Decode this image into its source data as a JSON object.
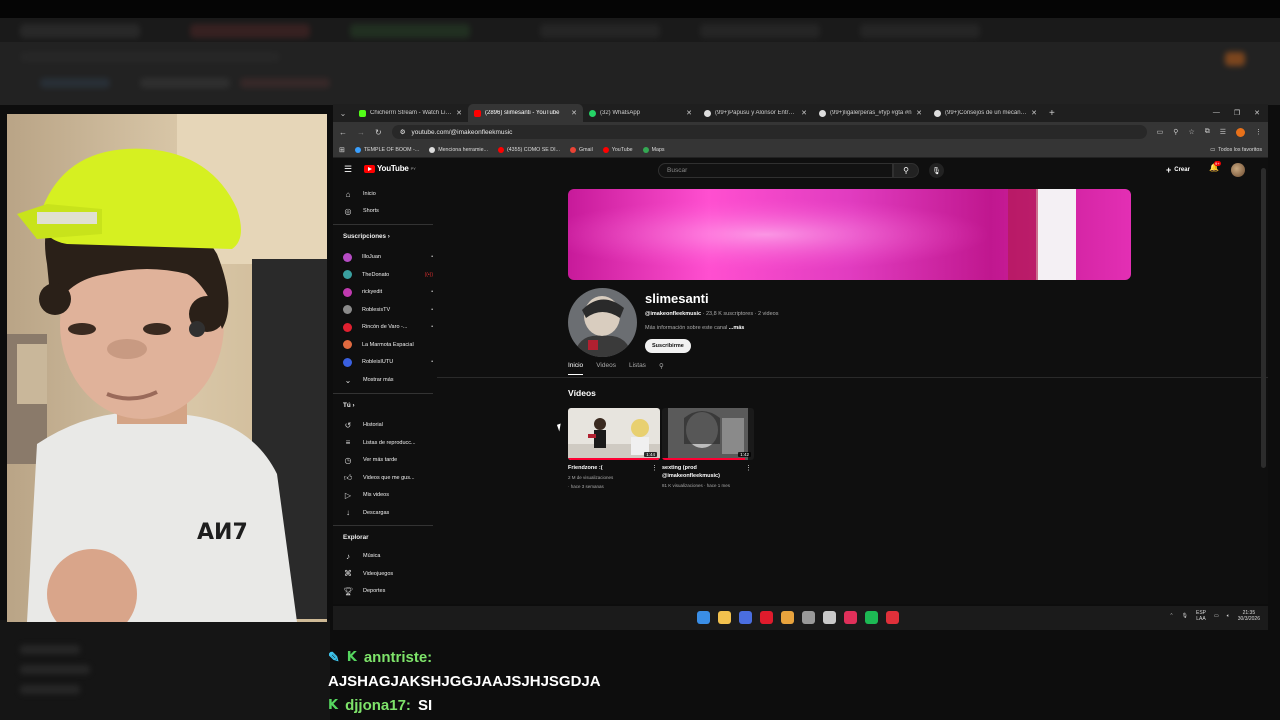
{
  "tabs": [
    {
      "label": "Chicherrri Stream - Watch Live on Kick",
      "icon_color": "#53fc18",
      "active": false
    },
    {
      "label": "(2896) slimesanti - YouTube",
      "icon_color": "#ff0000",
      "active": true
    },
    {
      "label": "(32) WhatsApp",
      "icon_color": "#25d366",
      "active": false
    },
    {
      "label": "(99+)Papusu y Alonsor Entre Amigos",
      "icon_color": "#ffffff",
      "active": false
    },
    {
      "label": "(99+)ligalerperas_#fyp #gta #n",
      "icon_color": "#ffffff",
      "active": false
    },
    {
      "label": "(99+)Consejos de un mecánico",
      "icon_color": "#ffffff",
      "active": false
    }
  ],
  "address": {
    "url": "youtube.com/@imakeonfleekmusic"
  },
  "bookmarks": [
    {
      "label": "TEMPLE OF BOOM -...",
      "color": "#3aa0ff"
    },
    {
      "label": "Menciona herramie...",
      "color": "#dddddd"
    },
    {
      "label": "(4355) COMO SE DI...",
      "color": "#ff0000"
    },
    {
      "label": "Gmail",
      "color": "#ea4335"
    },
    {
      "label": "YouTube",
      "color": "#ff0000"
    },
    {
      "label": "Maps",
      "color": "#34a853"
    }
  ],
  "bookmarks_right": "Todos los favoritos",
  "yt": {
    "logo": "YouTube",
    "logo_region": "PY",
    "search_placeholder": "Buscar",
    "create_label": "Crear",
    "bell_badge": "9+"
  },
  "sidebar": {
    "main": [
      {
        "label": "Inicio",
        "icon": "home-icon"
      },
      {
        "label": "Shorts",
        "icon": "shorts-icon"
      }
    ],
    "subs_header": "Suscripciones",
    "subs": [
      {
        "label": "IlloJuan",
        "color": "#b64cc4",
        "live": "•"
      },
      {
        "label": "TheDonato",
        "color": "#3aa0a0",
        "live": "((•))"
      },
      {
        "label": "rickyedit",
        "color": "#c03ab0",
        "live": "•"
      },
      {
        "label": "RoblesisTV",
        "color": "#8a8a8a",
        "live": "•"
      },
      {
        "label": "Rincón de Varo -...",
        "color": "#e02030",
        "live": "•"
      },
      {
        "label": "La Marmota Espacial",
        "color": "#e06a40",
        "live": ""
      },
      {
        "label": "RobleisIUTU",
        "color": "#3a60e0",
        "live": "•"
      }
    ],
    "show_more": "Mostrar más",
    "you_header": "Tú",
    "you": [
      {
        "label": "Historial",
        "icon": "history-icon"
      },
      {
        "label": "Listas de reproducc...",
        "icon": "playlists-icon"
      },
      {
        "label": "Ver más tarde",
        "icon": "watch-later-icon"
      },
      {
        "label": "Videos que me gus...",
        "icon": "like-icon"
      },
      {
        "label": "Mis videos",
        "icon": "my-videos-icon"
      },
      {
        "label": "Descargas",
        "icon": "download-icon"
      }
    ],
    "explore_header": "Explorar",
    "explore": [
      {
        "label": "Música",
        "icon": "music-icon"
      },
      {
        "label": "Videojuegos",
        "icon": "gaming-icon"
      },
      {
        "label": "Deportes",
        "icon": "sports-icon"
      }
    ]
  },
  "channel": {
    "name": "slimesanti",
    "handle": "@imakeonfleekmusic",
    "meta_rest": " · 23,8 K suscriptores · 2 videos",
    "more_text": "Más información sobre este canal",
    "more_link": " ...más",
    "subscribe": "Suscribirme",
    "tabs": [
      "Inicio",
      "Videos",
      "Listas"
    ],
    "section_title": "Vídeos"
  },
  "videos": [
    {
      "title": "Friendzone :(",
      "views": "2 M de visualizaciones",
      "age": "· hace 3 semanas",
      "duration": "1:44",
      "progress": 1.0
    },
    {
      "title": "sexting (prod @imakeonfleekmusic)",
      "views": "81 K visualizaciones · hace 1 mes",
      "age": "",
      "duration": "1:42",
      "progress": 0.9
    }
  ],
  "taskbar": {
    "icons": [
      {
        "name": "windows-start-icon",
        "color": "#3a8ee6"
      },
      {
        "name": "file-explorer-icon",
        "color": "#f2c14e"
      },
      {
        "name": "store-icon",
        "color": "#4a6ee0"
      },
      {
        "name": "opera-icon",
        "color": "#e01b2c"
      },
      {
        "name": "chrome-icon",
        "color": "#e8a33d"
      },
      {
        "name": "settings-icon",
        "color": "#999999"
      },
      {
        "name": "steam-icon",
        "color": "#c9c9c9"
      },
      {
        "name": "capcut-icon",
        "color": "#e0305a"
      },
      {
        "name": "spotify-icon",
        "color": "#1db954"
      },
      {
        "name": "record-icon",
        "color": "#e0303a"
      }
    ],
    "lang_top": "ESP",
    "lang_bottom": "LAA",
    "time": "21:35",
    "date": "30/3/2026"
  },
  "chat": [
    {
      "user": "anntriste:",
      "text": ""
    },
    {
      "user": "",
      "text": "AJSHAGJAKSHJGGJAAJSJHJSGDJA"
    },
    {
      "user": "djjona17:",
      "text": "SI"
    }
  ]
}
